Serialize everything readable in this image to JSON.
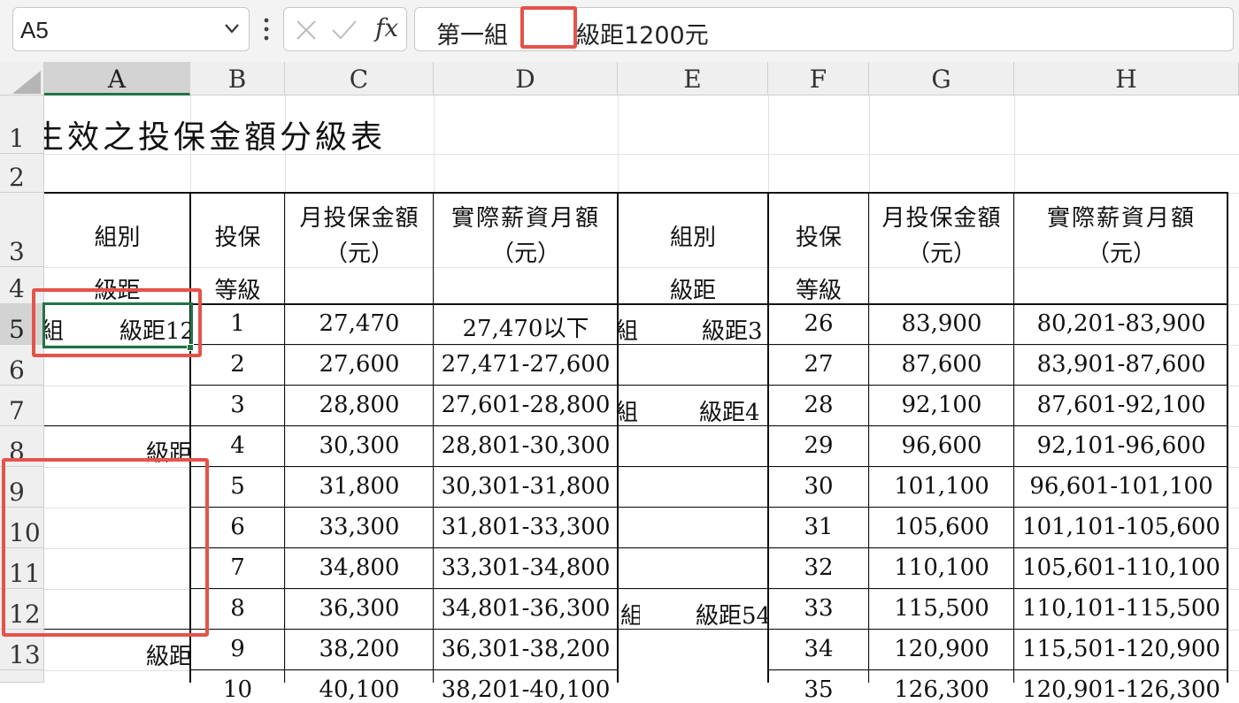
{
  "formula_bar": {
    "name_box": "A5",
    "fx_label": "fx",
    "formula_prefix": "第一組",
    "formula_suffix": "級距1200元"
  },
  "columns": [
    "A",
    "B",
    "C",
    "D",
    "E",
    "F",
    "G",
    "H"
  ],
  "rows": [
    "1",
    "2",
    "3",
    "4",
    "5",
    "6",
    "7",
    "8",
    "9",
    "10",
    "11",
    "12",
    "13"
  ],
  "sheet": {
    "title": "生效之投保金額分級表",
    "headers": {
      "group": "組別",
      "tier": "級距",
      "insure": "投保",
      "grade": "等級",
      "monthly_amount": "月投保金額",
      "actual_salary": "實際薪資月額",
      "unit": "（元）"
    },
    "left_cells": {
      "a5_group": "組",
      "a5_tier": "級距12",
      "a8_tier": "級距",
      "a13_tier": "級距"
    },
    "right_cells": {
      "e5_group": "組",
      "e5_tier": "級距3",
      "e7_group": "組",
      "e7_tier": "級距4",
      "e12_group": "組",
      "e12_tier": "級距54"
    },
    "left_table": [
      {
        "grade": "1",
        "amount": "27,470",
        "range": "27,470以下"
      },
      {
        "grade": "2",
        "amount": "27,600",
        "range": "27,471-27,600"
      },
      {
        "grade": "3",
        "amount": "28,800",
        "range": "27,601-28,800"
      },
      {
        "grade": "4",
        "amount": "30,300",
        "range": "28,801-30,300"
      },
      {
        "grade": "5",
        "amount": "31,800",
        "range": "30,301-31,800"
      },
      {
        "grade": "6",
        "amount": "33,300",
        "range": "31,801-33,300"
      },
      {
        "grade": "7",
        "amount": "34,800",
        "range": "33,301-34,800"
      },
      {
        "grade": "8",
        "amount": "36,300",
        "range": "34,801-36,300"
      },
      {
        "grade": "9",
        "amount": "38,200",
        "range": "36,301-38,200"
      },
      {
        "grade": "10",
        "amount": "40,100",
        "range": "38,201-40,100"
      }
    ],
    "right_table": [
      {
        "grade": "26",
        "amount": "83,900",
        "range": "80,201-83,900"
      },
      {
        "grade": "27",
        "amount": "87,600",
        "range": "83,901-87,600"
      },
      {
        "grade": "28",
        "amount": "92,100",
        "range": "87,601-92,100"
      },
      {
        "grade": "29",
        "amount": "96,600",
        "range": "92,101-96,600"
      },
      {
        "grade": "30",
        "amount": "101,100",
        "range": "96,601-101,100"
      },
      {
        "grade": "31",
        "amount": "105,600",
        "range": "101,101-105,600"
      },
      {
        "grade": "32",
        "amount": "110,100",
        "range": "105,601-110,100"
      },
      {
        "grade": "33",
        "amount": "115,500",
        "range": "110,101-115,500"
      },
      {
        "grade": "34",
        "amount": "120,900",
        "range": "115,501-120,900"
      },
      {
        "grade": "35",
        "amount": "126,300",
        "range": "120,901-126,300"
      }
    ]
  },
  "colors": {
    "highlight": "#e4534a",
    "selection": "#217346",
    "header_bg": "#efefef"
  }
}
